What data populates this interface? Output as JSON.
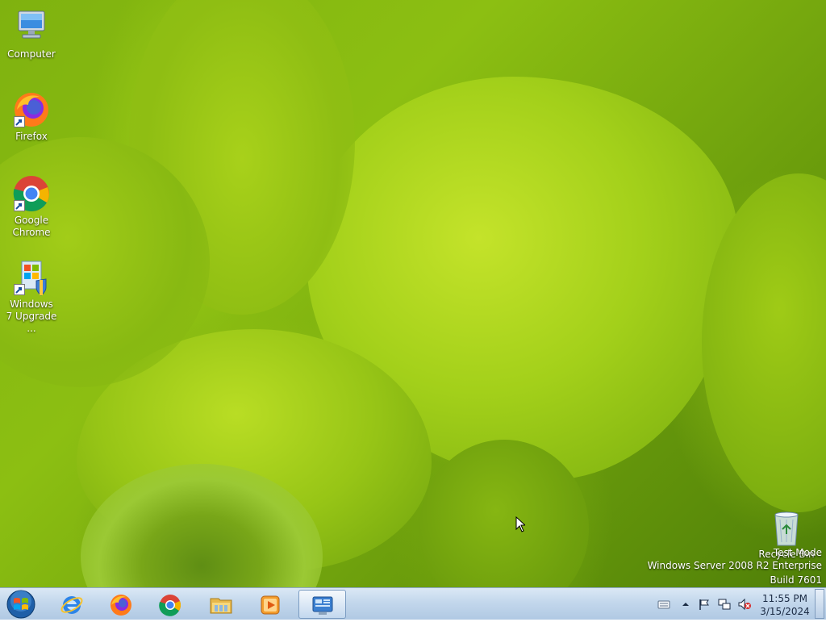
{
  "desktop": {
    "icons": [
      {
        "label": "Computer",
        "icon": "computer-icon"
      },
      {
        "label": "Firefox",
        "icon": "firefox-icon"
      },
      {
        "label": "Google Chrome",
        "icon": "chrome-icon"
      },
      {
        "label": "Windows 7 Upgrade ...",
        "icon": "windows-upgrade-icon"
      },
      {
        "label": "Recycle Bin",
        "icon": "recycle-bin-icon"
      }
    ],
    "watermark": {
      "line1": "Test Mode",
      "line2": "Windows Server 2008 R2 Enterprise",
      "line3": "Build 7601"
    }
  },
  "taskbar": {
    "start": {
      "icon": "windows-start-orb-icon"
    },
    "pinned": [
      {
        "name": "internet-explorer",
        "icon": "internet-explorer-icon"
      },
      {
        "name": "firefox",
        "icon": "firefox-icon"
      },
      {
        "name": "chrome",
        "icon": "chrome-icon"
      },
      {
        "name": "windows-explorer",
        "icon": "folder-icon"
      },
      {
        "name": "media-player",
        "icon": "media-player-icon"
      },
      {
        "name": "server-manager",
        "icon": "server-manager-icon",
        "active": true
      }
    ],
    "tray": {
      "icons": [
        "keyboard-icon",
        "show-hidden-icons-chevron-icon",
        "action-center-flag-icon",
        "network-icon",
        "volume-muted-icon"
      ],
      "time": "11:55 PM",
      "date": "3/15/2024"
    }
  },
  "colors": {
    "taskbar": "#c3d7ec",
    "wallpaper_green": "#97c514"
  }
}
